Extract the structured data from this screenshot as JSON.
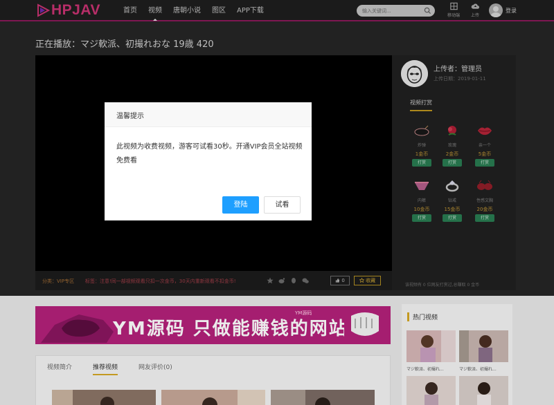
{
  "header": {
    "logo_text": "HPJAV",
    "menu": [
      {
        "label": "首页"
      },
      {
        "label": "视频",
        "active": true
      },
      {
        "label": "唐朝小说"
      },
      {
        "label": "图区"
      },
      {
        "label": "APP下载"
      }
    ],
    "search_placeholder": "输入关键词...",
    "tools": [
      {
        "label": "移动端",
        "icon": "mobile-icon"
      },
      {
        "label": "上传",
        "icon": "cloud-upload-icon"
      }
    ],
    "login_label": "登录"
  },
  "video": {
    "title": "正在播放：マジ軟派、初撮れおな 19歳 420",
    "category": "分类：VIP专区",
    "tags": "标签：注意!同一部视频观看只扣一次金币，30天内重新观看不扣金币!",
    "like_label": "0",
    "fav_label": "收藏"
  },
  "uploader": {
    "name": "上传者：管理员",
    "date": "上传日期：2019-01-11"
  },
  "tips": {
    "title": "视频打赏",
    "gifts": [
      {
        "name": "炸弹",
        "price": "1金币",
        "btn": "打赏",
        "icon": "bomb-icon"
      },
      {
        "name": "玫瑰",
        "price": "2金币",
        "btn": "打赏",
        "icon": "rose-icon"
      },
      {
        "name": "亲一个",
        "price": "5金币",
        "btn": "打赏",
        "icon": "lips-icon"
      },
      {
        "name": "内裤",
        "price": "10金币",
        "btn": "打赏",
        "icon": "underwear-icon"
      },
      {
        "name": "钻戒",
        "price": "15金币",
        "btn": "打赏",
        "icon": "ring-icon"
      },
      {
        "name": "性感文胸",
        "price": "20金币",
        "btn": "打赏",
        "icon": "bra-icon"
      }
    ],
    "stats": "该视频有 0 位网友打赏过,总赚取 0 金币"
  },
  "modal": {
    "title": "温馨提示",
    "body": "此视频为收费视频，游客可试看30秒。开通VIP会员全站视频免费看",
    "login_btn": "登陆",
    "try_btn": "试看"
  },
  "banner": {
    "main_text": "YM源码  只做能赚钱的网站",
    "badge": "YM源码"
  },
  "tabs": [
    {
      "label": "视频简介"
    },
    {
      "label": "推荐视频",
      "active": true
    },
    {
      "label": "网友评价(0)"
    }
  ],
  "hot": {
    "title": "热门视频",
    "items": [
      {
        "caption": "マジ軟派、初撮れ..."
      },
      {
        "caption": "マジ軟派、初撮れ..."
      }
    ]
  },
  "colors": {
    "accent_pink": "#e0397f",
    "brand_magenta": "#b3217a",
    "gold": "#d4a623",
    "blue_button": "#1e9fff",
    "green_button": "#2e8a5b"
  }
}
